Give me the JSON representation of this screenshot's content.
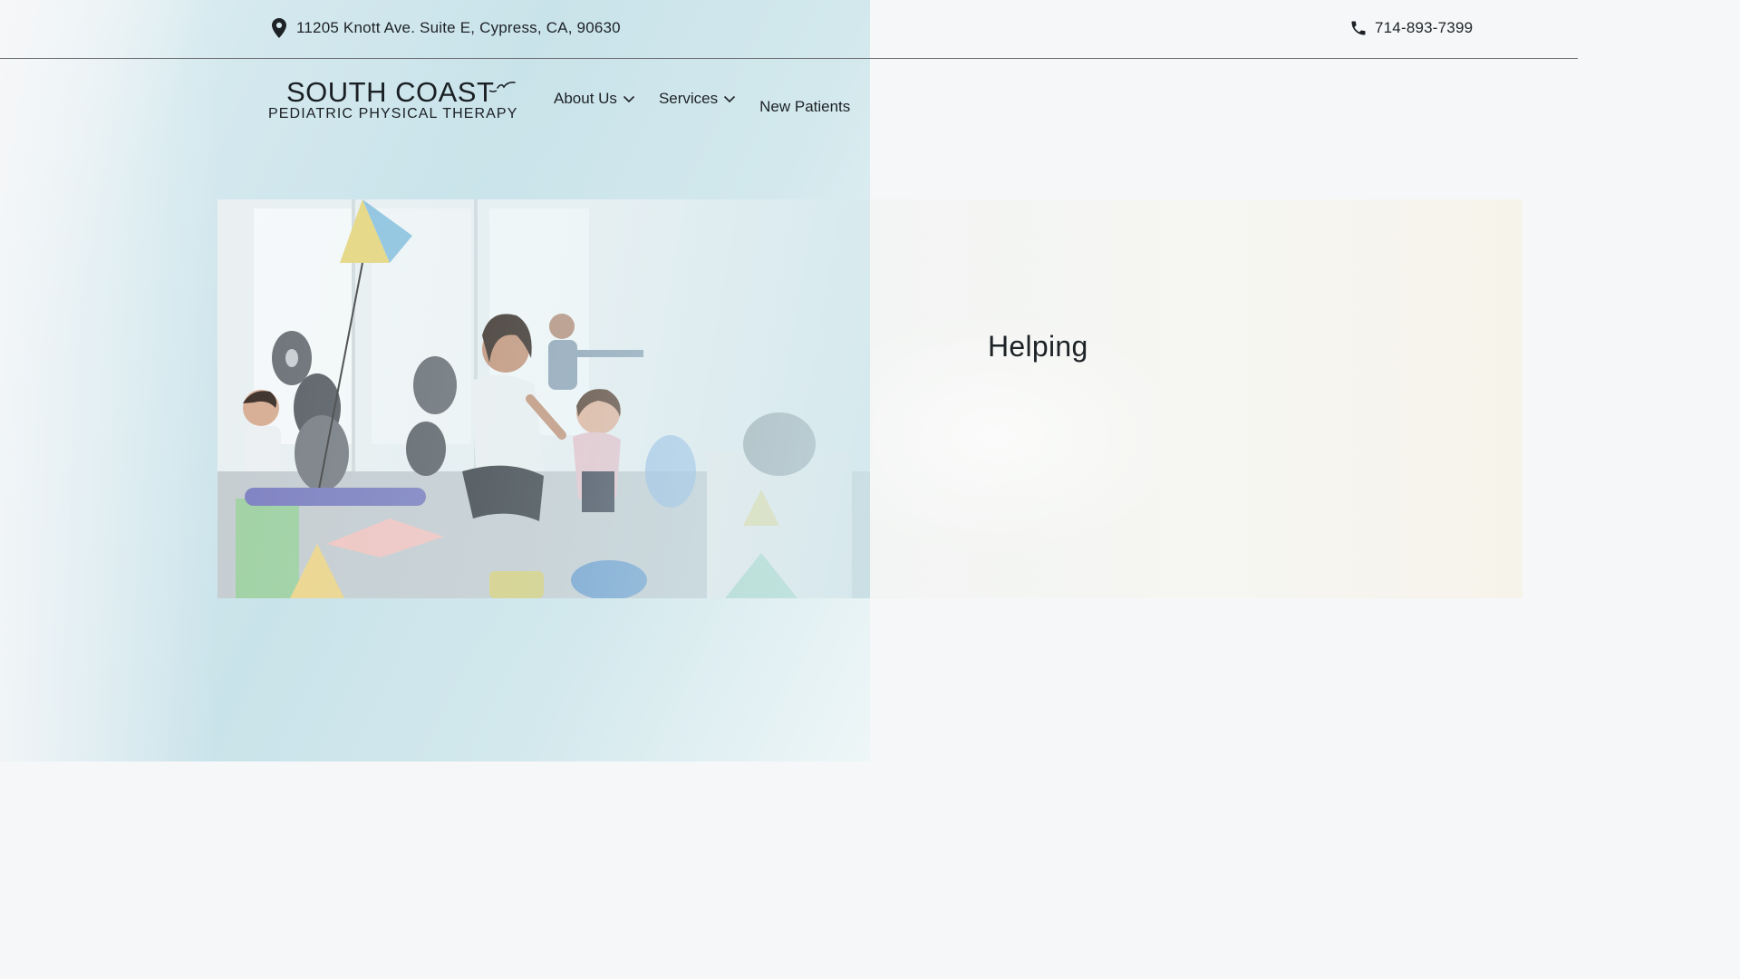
{
  "topbar": {
    "address": "11205 Knott Ave. Suite E, Cypress, CA, 90630",
    "address_icon": "map-pin-icon",
    "phone": "714-893-7399",
    "phone_icon": "phone-icon"
  },
  "header": {
    "logo_main": "SOUTH COAST",
    "logo_sub": "PEDIATRIC PHYSICAL THERAPY",
    "logo_icon": "bird-icon"
  },
  "nav": {
    "items": [
      {
        "label": "About Us",
        "has_dropdown": true
      },
      {
        "label": "Services",
        "has_dropdown": true
      },
      {
        "label": "New Patients",
        "has_dropdown": false
      }
    ],
    "dropdown_icon": "chevron-down-icon"
  },
  "hero": {
    "title": "Helping",
    "image_alt": "therapist-with-children-in-gym"
  },
  "colors": {
    "background": "#f6f7f9",
    "text": "#1d2226",
    "accent_teal": "#c9e3ea",
    "divider": "#6e7276"
  }
}
